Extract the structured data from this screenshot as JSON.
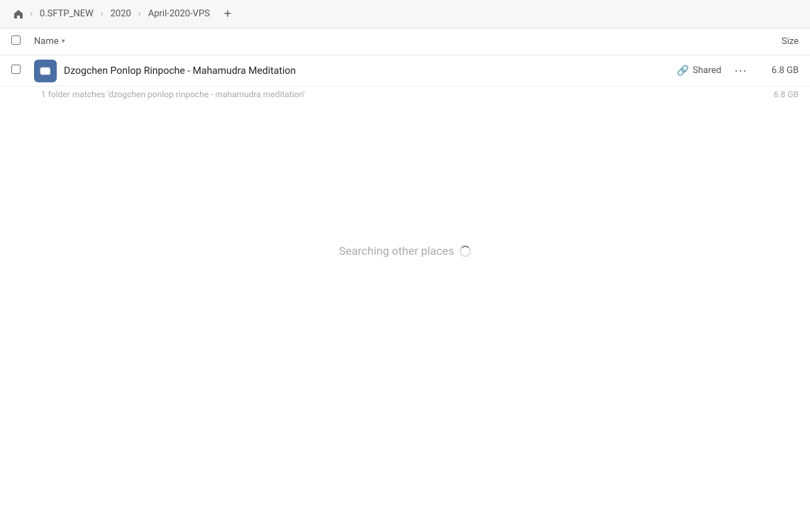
{
  "breadcrumb": {
    "home_icon": "home",
    "items": [
      {
        "label": "0.SFTP_NEW"
      },
      {
        "label": "2020"
      },
      {
        "label": "April-2020-VPS"
      }
    ],
    "add_button_label": "+"
  },
  "column_header": {
    "checkbox_label": "select-all",
    "name_label": "Name",
    "name_chevron": "▾",
    "size_label": "Size"
  },
  "file_row": {
    "name": "Dzogchen Ponlop Rinpoche - Mahamudra Meditation",
    "shared_label": "Shared",
    "size": "6.8 GB",
    "more_options": "···"
  },
  "match_hint": {
    "text": "1 folder matches 'dzogchen ponlop rinpoche - mahamudra meditation'",
    "size": "6.8 GB"
  },
  "searching": {
    "text": "Searching other places"
  }
}
